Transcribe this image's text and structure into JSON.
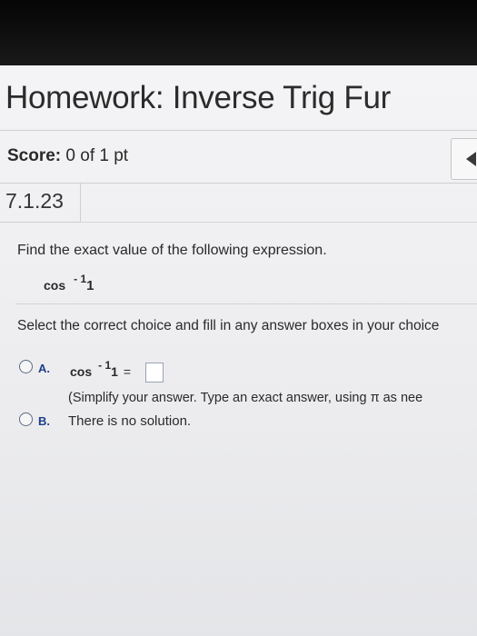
{
  "header": {
    "title": "Homework: Inverse Trig Fur"
  },
  "score": {
    "label": "Score:",
    "value": "0 of 1 pt"
  },
  "nav": {
    "prev_icon": "triangle-left-icon"
  },
  "question": {
    "number": "7.1.23",
    "prompt": "Find the exact value of the following expression.",
    "expression": {
      "func": "cos",
      "exponent": "- 1",
      "argument": "1"
    },
    "instruction": "Select the correct choice and fill in any answer boxes in your choice"
  },
  "choices": [
    {
      "letter": "A.",
      "func": "cos",
      "exponent": "- 1",
      "argument": "1",
      "equals": " =",
      "answer_value": "",
      "hint": "(Simplify your answer. Type an exact answer, using π as nee"
    },
    {
      "letter": "B.",
      "text": "There is no solution."
    }
  ]
}
